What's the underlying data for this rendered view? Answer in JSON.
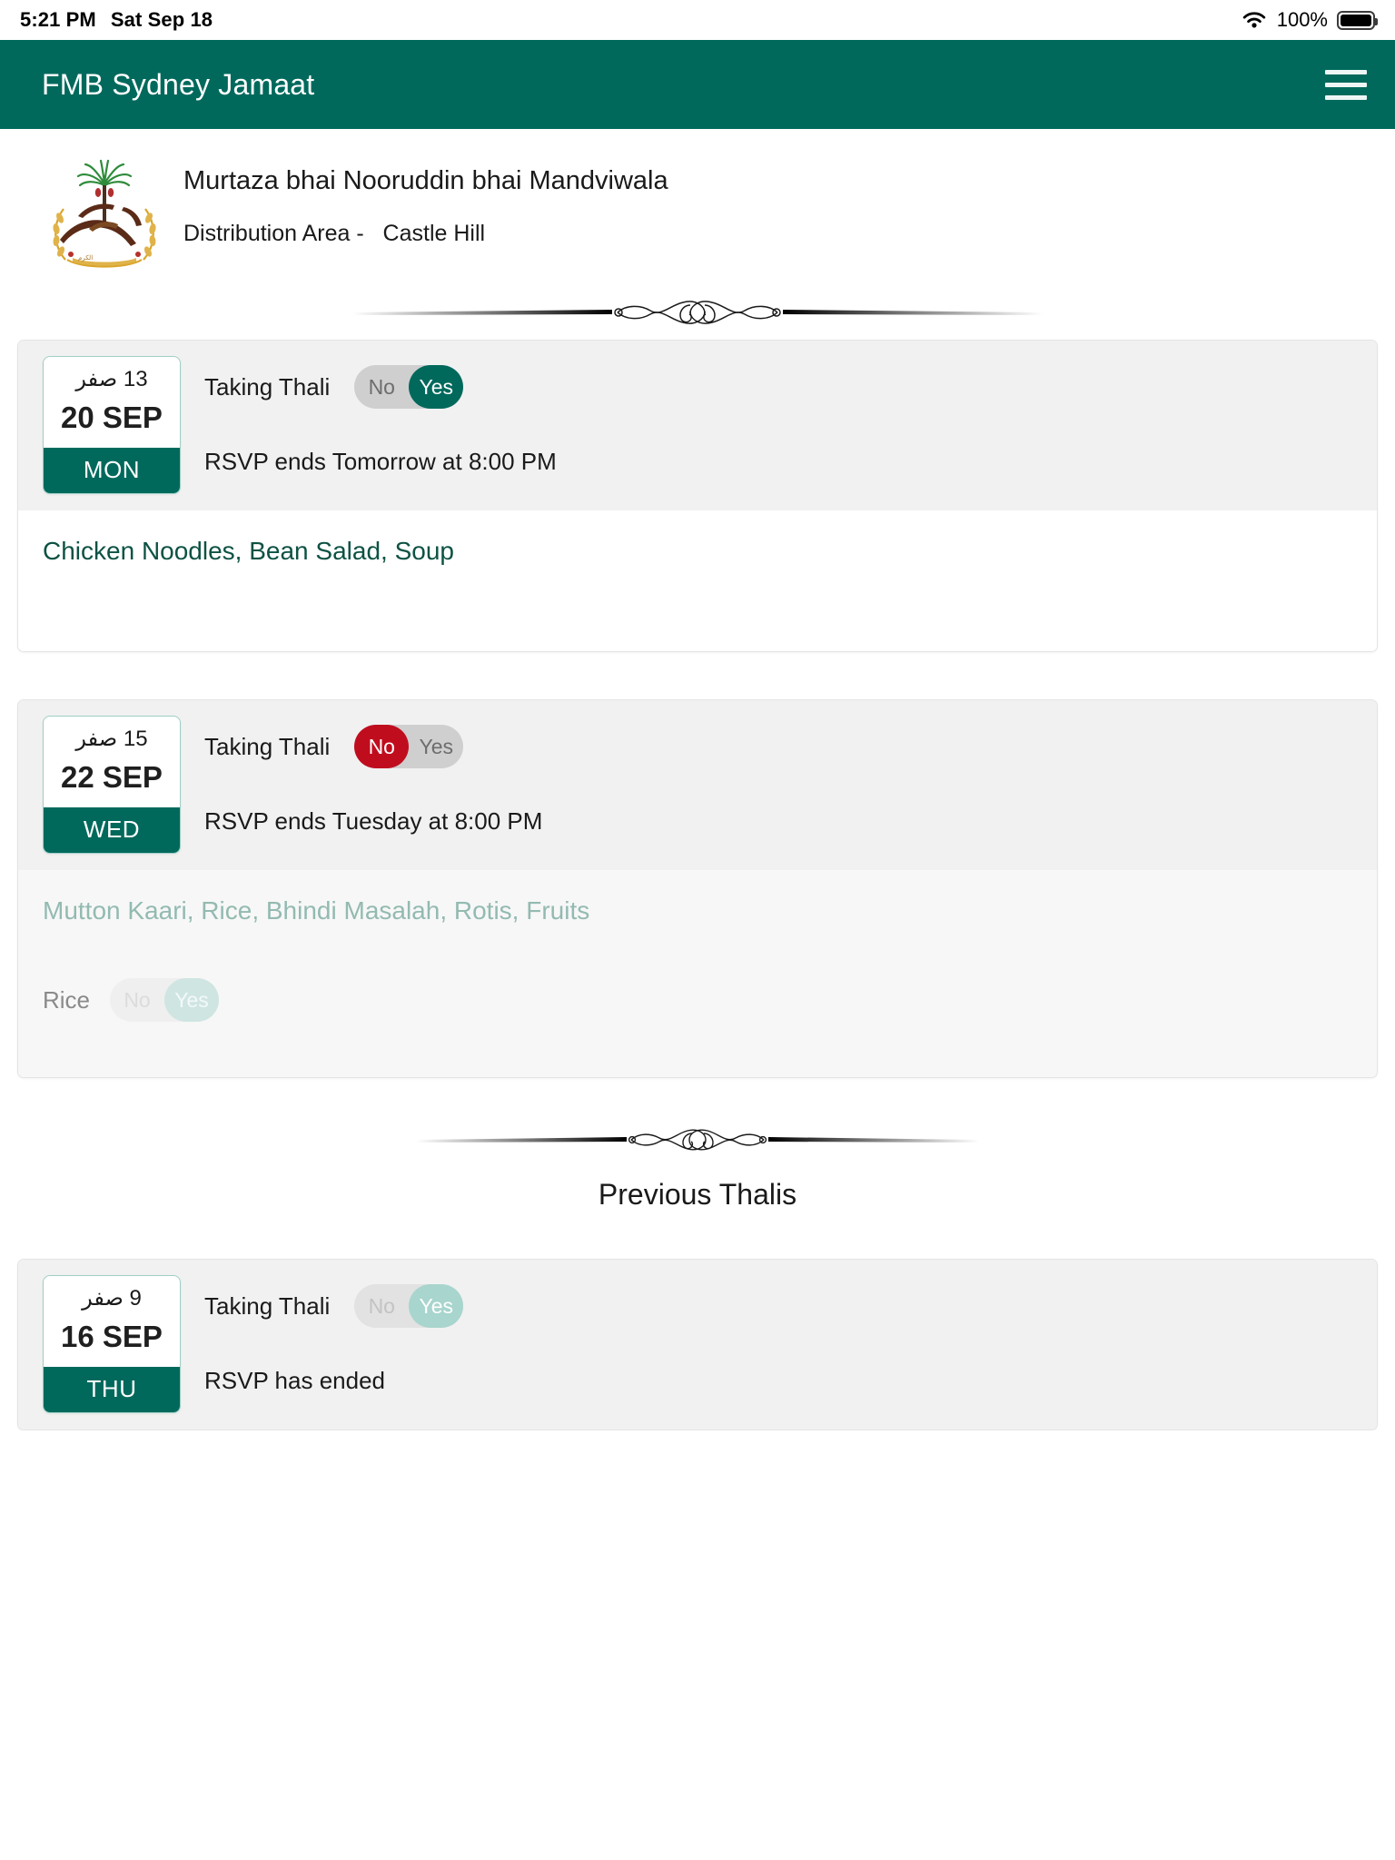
{
  "statusbar": {
    "time": "5:21 PM",
    "date": "Sat Sep 18",
    "battery_percent": "100%",
    "wifi_icon": "wifi-icon",
    "battery_icon": "battery-full-icon"
  },
  "appbar": {
    "title": "FMB Sydney Jamaat",
    "menu_icon": "hamburger-menu-icon",
    "background_color": "#00695c"
  },
  "profile": {
    "logo_alt": "burhani-logo",
    "name": "Murtaza bhai Nooruddin bhai Mandviwala",
    "area_label": "Distribution Area -",
    "area_value": "Castle Hill"
  },
  "toggle_options": {
    "no": "No",
    "yes": "Yes"
  },
  "labels": {
    "taking_thali": "Taking Thali",
    "previous_thalis": "Previous Thalis"
  },
  "colors": {
    "brand_green": "#00695c",
    "menu_green": "#0d5243",
    "no_red": "#c00d1e",
    "muted_green": "#93bab1",
    "card_head_grey": "#f1f1f1"
  },
  "upcoming": [
    {
      "hijri": "13 صفر",
      "gregorian": "20 SEP",
      "day": "MON",
      "taking_thali": "Yes",
      "rsvp": "RSVP ends Tomorrow at 8:00 PM",
      "menu": "Chicken Noodles, Bean Salad, Soup",
      "sides": []
    },
    {
      "hijri": "15 صفر",
      "gregorian": "22 SEP",
      "day": "WED",
      "taking_thali": "No",
      "rsvp": "RSVP ends Tuesday at 8:00 PM",
      "menu": "Mutton Kaari, Rice, Bhindi Masalah, Rotis, Fruits",
      "sides": [
        {
          "label": "Rice",
          "value": "Yes"
        }
      ]
    }
  ],
  "previous": [
    {
      "hijri": "9 صفر",
      "gregorian": "16 SEP",
      "day": "THU",
      "taking_thali": "Yes",
      "rsvp": "RSVP has ended",
      "menu": "",
      "sides": []
    }
  ]
}
